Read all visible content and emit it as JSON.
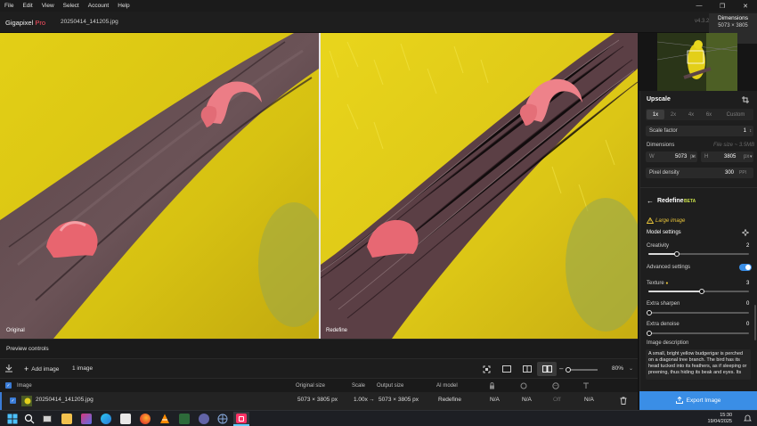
{
  "menu": [
    "File",
    "Edit",
    "View",
    "Select",
    "Account",
    "Help"
  ],
  "app": {
    "name": "Gigapixel",
    "name_suffix": "Pro",
    "filename": "20250414_141205.jpg",
    "version": "v4.3.2"
  },
  "dimensions": {
    "title": "Dimensions",
    "value": "5073 × 3805"
  },
  "preview": {
    "left_label": "Original",
    "right_label": "Redefine"
  },
  "preview_controls_label": "Preview controls",
  "toolbar": {
    "add_image": "Add image",
    "image_count": "1 image",
    "zoom": "80%"
  },
  "table": {
    "headers": {
      "image": "Image",
      "original_size": "Original size",
      "scale": "Scale",
      "output_size": "Output size",
      "ai_model": "AI model"
    },
    "row": {
      "name": "20250414_141205.jpg",
      "original_size": "5073 × 3805 px",
      "scale": "1.00x",
      "arrow": "→",
      "output_size": "5073 × 3805 px",
      "ai_model": "Redefine",
      "c1": "N/A",
      "c2": "N/A",
      "c3": "Off",
      "c4": "N/A"
    }
  },
  "upscale": {
    "title": "Upscale",
    "options": [
      "1x",
      "2x",
      "4x",
      "6x",
      "Custom"
    ],
    "selected": "1x",
    "scale_factor_label": "Scale factor",
    "scale_factor_value": "1",
    "dimensions_label": "Dimensions",
    "file_size": "File size ~ 3.5MB",
    "w_label": "W",
    "w_value": "5073",
    "w_unit": "px",
    "h_label": "H",
    "h_value": "3805",
    "h_unit": "px",
    "density_label": "Pixel density",
    "density_value": "300",
    "density_unit": "PPI"
  },
  "redefine": {
    "title": "Redefine",
    "badge": "BETA",
    "warning": "Large image",
    "model_settings": "Model settings",
    "creativity_label": "Creativity",
    "creativity_value": "2",
    "creativity_frac": 0.28,
    "advanced_label": "Advanced settings",
    "advanced_on": true,
    "texture_label": "Texture",
    "texture_value": "3",
    "texture_frac": 0.53,
    "sharpen_label": "Extra sharpen",
    "sharpen_value": "0",
    "denoise_label": "Extra denoise",
    "denoise_value": "0",
    "desc_label": "Image description",
    "desc_text": "A small, bright yellow budgerigar is perched on a diagonal tree branch. The bird has its head tucked into its feathers, as if sleeping or preening, thus hiding its beak and eyes. Its"
  },
  "export_label": "Export Image",
  "clock": {
    "time": "15:30",
    "date": "19/04/2025"
  },
  "colors": {
    "accent": "#3a8ee6",
    "brand": "#ff4f63",
    "bird": "#e8d21a"
  }
}
